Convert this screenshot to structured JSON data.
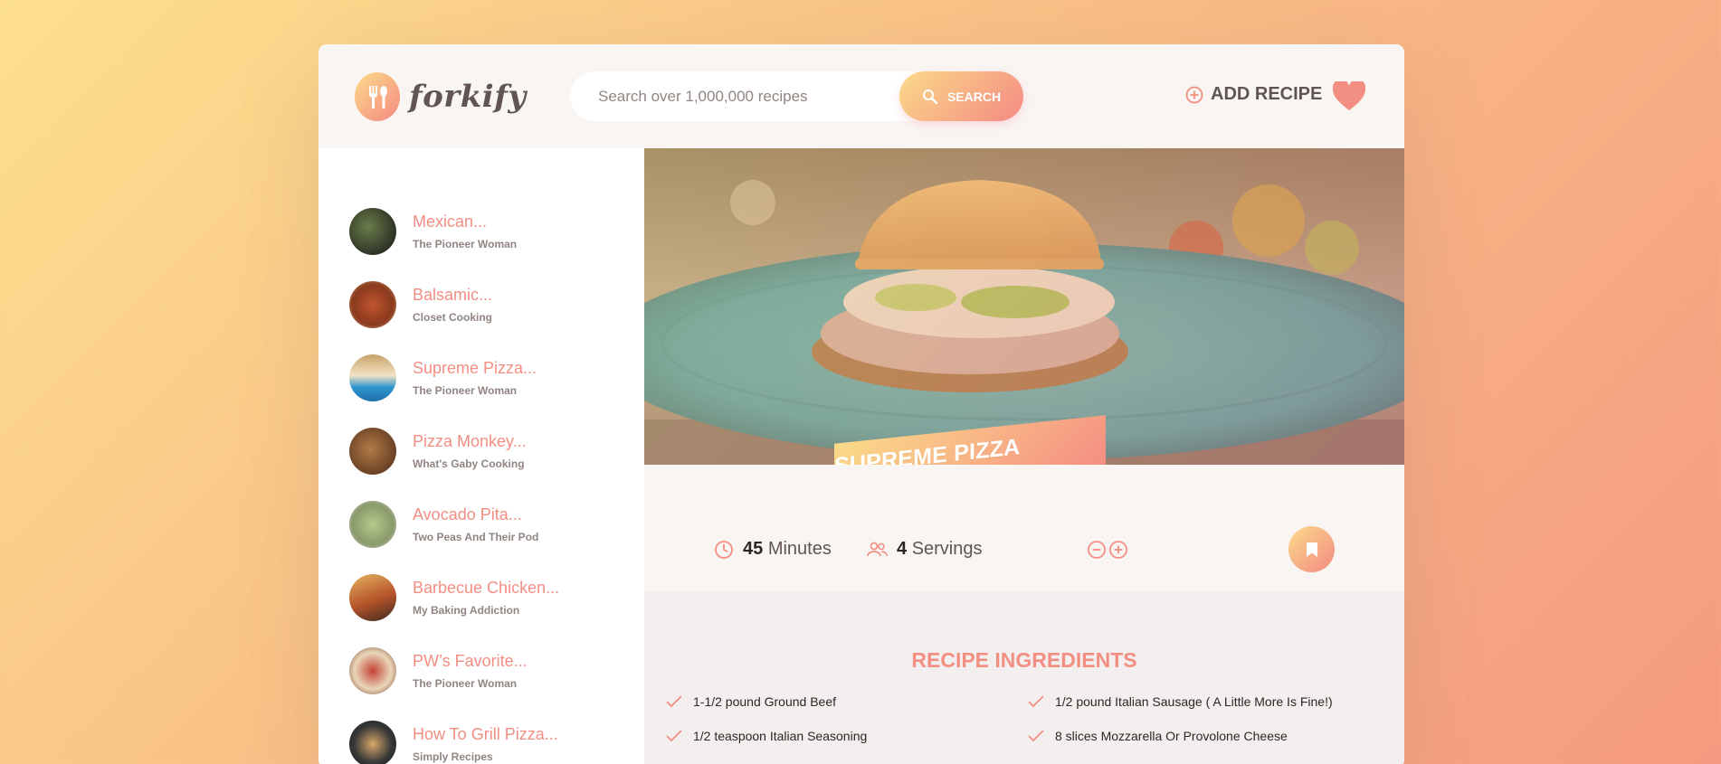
{
  "header": {
    "logo_text": "forkify",
    "search_placeholder": "Search over 1,000,000 recipes",
    "search_button": "Search",
    "add_recipe": "Add recipe"
  },
  "results": [
    {
      "title": "Mexican...",
      "publisher": "The Pioneer Woman"
    },
    {
      "title": "Balsamic...",
      "publisher": "Closet Cooking"
    },
    {
      "title": "Supreme Pizza...",
      "publisher": "The Pioneer Woman"
    },
    {
      "title": "Pizza Monkey...",
      "publisher": "What's Gaby Cooking"
    },
    {
      "title": "Avocado Pita...",
      "publisher": "Two Peas And Their Pod"
    },
    {
      "title": "Barbecue Chicken...",
      "publisher": "My Baking Addiction"
    },
    {
      "title": "PW’s Favorite...",
      "publisher": "The Pioneer Woman"
    },
    {
      "title": "How To Grill Pizza...",
      "publisher": "Simply Recipes"
    }
  ],
  "recipe": {
    "title": "Supreme Pizza Burgers",
    "minutes": "45",
    "minutes_label": "Minutes",
    "servings": "4",
    "servings_label": "Servings"
  },
  "ingredients": {
    "heading": "Recipe ingredients",
    "items": [
      "1-1/2 pound Ground Beef",
      "1/2 pound Italian Sausage ( A Little More Is Fine!)",
      "1/2 teaspoon Italian Seasoning",
      "8 slices Mozzarella Or Provolone Cheese"
    ]
  },
  "colors": {
    "accent": "#f38e82",
    "gradient_start": "#fbdb89",
    "gradient_end": "#f48982",
    "text": "#615551"
  }
}
